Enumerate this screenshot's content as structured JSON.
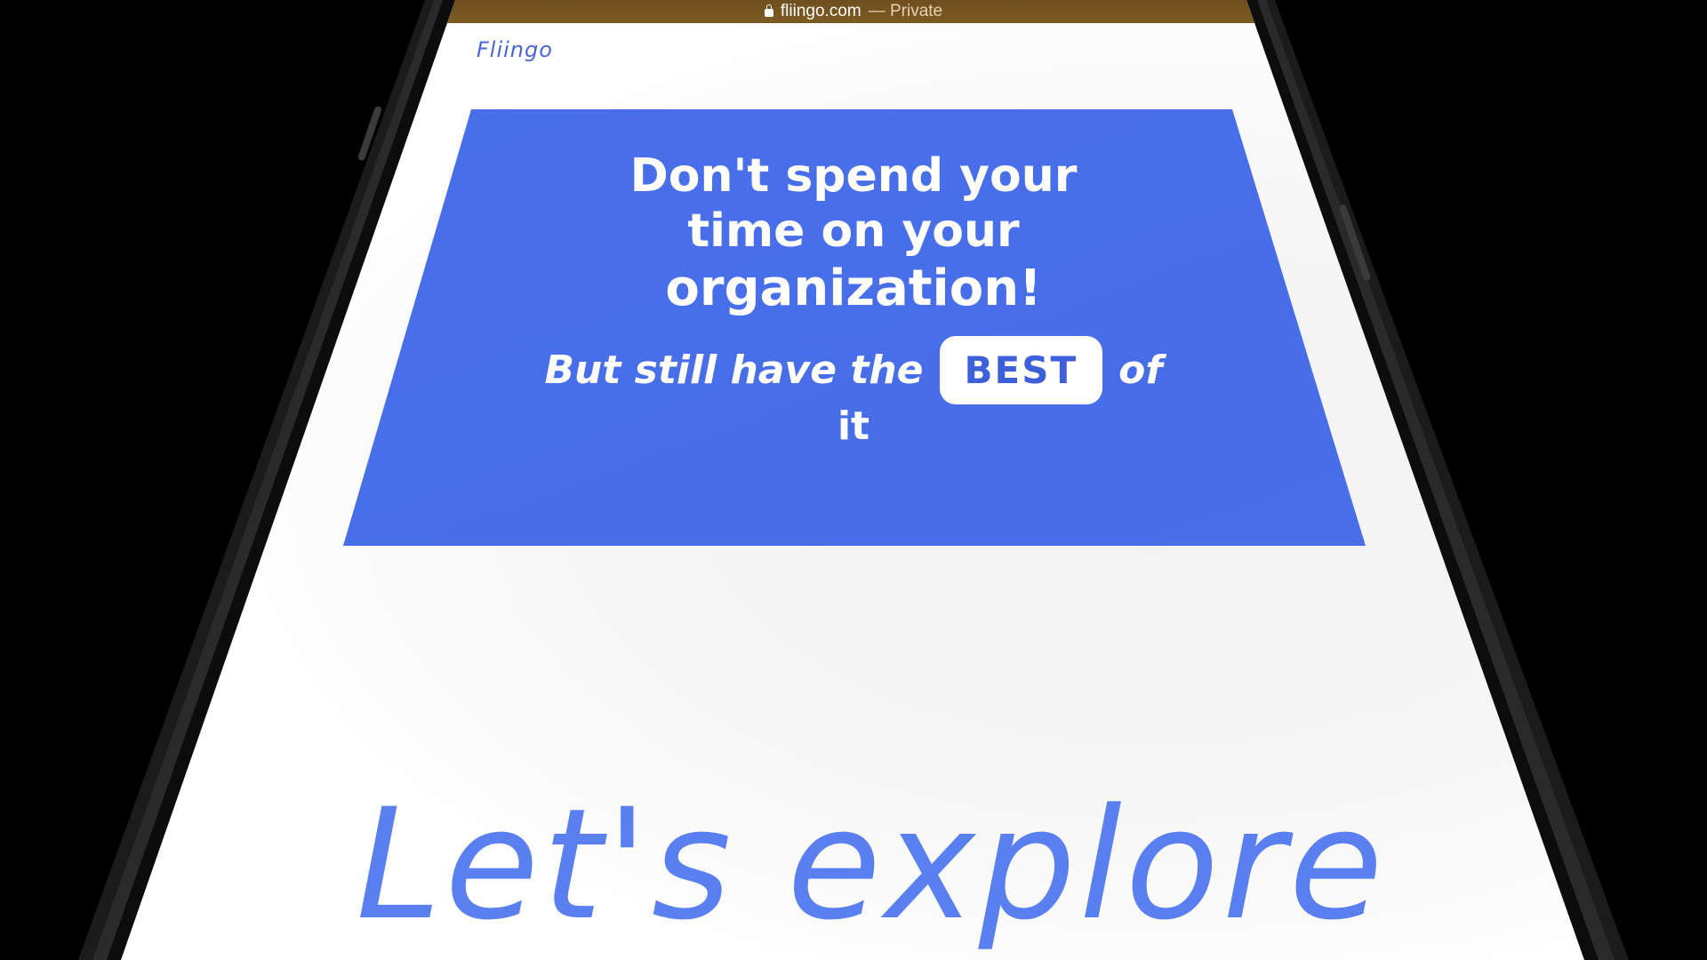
{
  "browser": {
    "domain": "fliingo.com",
    "mode": "— Private",
    "bar_color": "#7c5a22"
  },
  "site": {
    "brand": "Fliingo",
    "accent_color": "#476ee8"
  },
  "hero": {
    "line1": "Don't spend your",
    "line2": "time on your",
    "line3": "organization!",
    "sub_prefix": "But still have the",
    "badge": "BEST",
    "sub_suffix": "of",
    "sub_line2": "it"
  },
  "explore": {
    "heading": "Let's explore"
  }
}
